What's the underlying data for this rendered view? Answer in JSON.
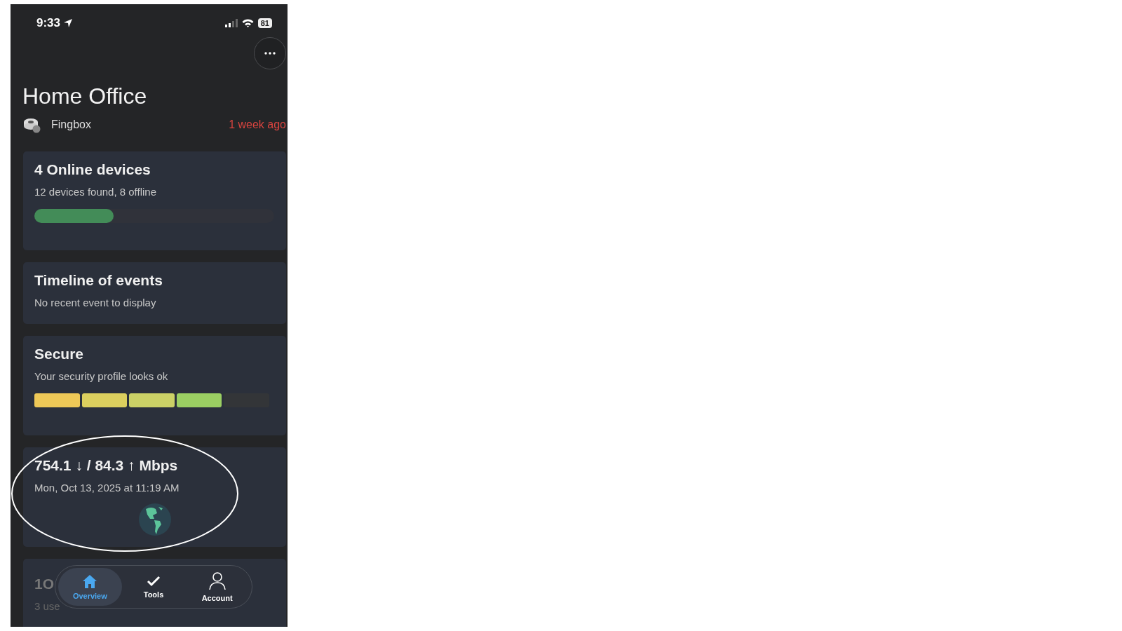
{
  "status_bar": {
    "time": "9:33",
    "battery": "81"
  },
  "network": {
    "title": "Home Office",
    "device": "Fingbox",
    "last_seen": "1 week ago"
  },
  "cards": [
    {
      "kind": "progress",
      "title": "4 Online devices",
      "subtitle": "12 devices found, 8 offline",
      "level": 0.33
    },
    {
      "kind": "text",
      "title": "Timeline of events",
      "subtitle": "No recent event to display"
    },
    {
      "kind": "segments",
      "title": "Secure",
      "subtitle": "Your security profile looks ok",
      "segments": [
        {
          "filled": true,
          "color": "#eec857"
        },
        {
          "filled": true,
          "color": "#dccf5e"
        },
        {
          "filled": true,
          "color": "#cbd166"
        },
        {
          "filled": true,
          "color": "#9bcf62"
        },
        {
          "filled": false
        }
      ]
    },
    {
      "kind": "speed",
      "title": "754.1 ↓ / 84.3 ↑ Mbps",
      "subtitle": "Mon, Oct 13, 2025 at 11:19 AM"
    },
    {
      "kind": "partial",
      "title": "1O",
      "subtitle": "3 use"
    }
  ],
  "tabs": [
    {
      "label": "Overview",
      "kind": "home",
      "selected": true
    },
    {
      "label": "Tools",
      "kind": "check",
      "selected": false
    },
    {
      "label": "Account",
      "kind": "person",
      "selected": false
    }
  ],
  "annotation": {
    "kind": "ellipse"
  }
}
